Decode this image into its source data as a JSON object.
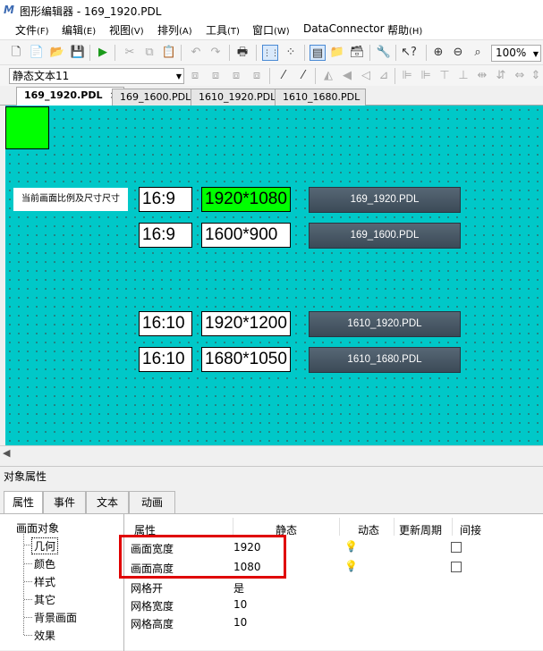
{
  "window": {
    "title": "图形编辑器 - 169_1920.PDL",
    "logo_glyph": "M"
  },
  "menu": [
    {
      "label": "文件",
      "hotkey": "(F)"
    },
    {
      "label": "编辑",
      "hotkey": "(E)"
    },
    {
      "label": "视图",
      "hotkey": "(V)"
    },
    {
      "label": "排列",
      "hotkey": "(A)"
    },
    {
      "label": "工具",
      "hotkey": "(T)"
    },
    {
      "label": "窗口",
      "hotkey": "(W)"
    },
    {
      "label": "DataConnector",
      "hotkey": ""
    },
    {
      "label": "帮助",
      "hotkey": "(H)"
    }
  ],
  "toolbar": {
    "zoom": "100%",
    "object_selector": "静态文本11"
  },
  "doc_tabs": [
    {
      "label": "169_1920.PDL",
      "active": true,
      "close": "×"
    },
    {
      "label": "169_1600.PDL",
      "active": false
    },
    {
      "label": "1610_1920.PDL",
      "active": false
    },
    {
      "label": "1610_1680.PDL",
      "active": false
    }
  ],
  "canvas": {
    "background": "#00c8c8",
    "label": "当前画面比例及尺寸尺寸",
    "rows": [
      {
        "ratio": "16:9",
        "size": "1920*1080",
        "highlight": true,
        "button": "169_1920.PDL"
      },
      {
        "ratio": "16:9",
        "size": "1600*900",
        "highlight": false,
        "button": "169_1600.PDL"
      },
      {
        "ratio": "16:10",
        "size": "1920*1200",
        "highlight": false,
        "button": "1610_1920.PDL"
      },
      {
        "ratio": "16:10",
        "size": "1680*1050",
        "highlight": false,
        "button": "1610_1680.PDL"
      }
    ]
  },
  "props": {
    "header": "对象属性",
    "tabs": [
      "属性",
      "事件",
      "文本",
      "动画"
    ],
    "tree_root": "画面对象",
    "tree_items": [
      "几何",
      "颜色",
      "样式",
      "其它",
      "背景画面",
      "效果"
    ],
    "columns": [
      "属性",
      "静态",
      "动态",
      "更新周期",
      "间接"
    ],
    "rows": [
      {
        "name": "画面宽度",
        "value": "1920",
        "dynamic": true,
        "indirect": true
      },
      {
        "name": "画面高度",
        "value": "1080",
        "dynamic": true,
        "indirect": true
      },
      {
        "name": "网格开",
        "value": "是",
        "dynamic": false,
        "indirect": false
      },
      {
        "name": "网格宽度",
        "value": "10",
        "dynamic": false,
        "indirect": false
      },
      {
        "name": "网格高度",
        "value": "10",
        "dynamic": false,
        "indirect": false
      }
    ]
  }
}
